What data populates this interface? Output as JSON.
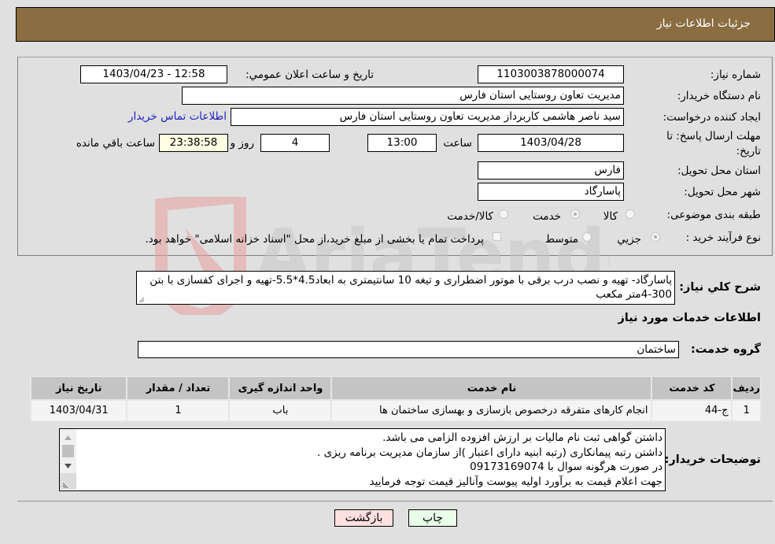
{
  "header": {
    "title": "جزئيات اطلاعات نياز"
  },
  "fields": {
    "need_number_label": "شماره نياز:",
    "need_number": "1103003878000074",
    "announce_label": "تاريخ و ساعت اعلان عمومي:",
    "announce_value": "1403/04/23 - 12:58",
    "buyer_org_label": "نام دستگاه خريدار:",
    "buyer_org": "مديريت تعاون روستايی استان فارس",
    "creator_label": "ايجاد کننده درخواست:",
    "creator": "سيد ناصر هاشمی کاربرداز مديريت تعاون روستايی استان فارس",
    "contact_link": "اطلاعات تماس خريدار",
    "deadline_label": "مهلت ارسال پاسخ: تا تاريخ:",
    "deadline_date": "1403/04/28",
    "time_label": "ساعت",
    "deadline_time": "13:00",
    "days_value": "4",
    "days_label": "روز و",
    "remaining_time": "23:38:58",
    "remaining_label": "ساعت باقي مانده",
    "province_label": "استان محل تحويل:",
    "province": "فارس",
    "city_label": "شهر محل تحويل:",
    "city": "پاسارگاد",
    "category_label": "طبقه بندی موضوعی:",
    "category_options": [
      "کالا",
      "خدمت",
      "کالا/خدمت"
    ],
    "category_selected": "خدمت",
    "process_label": "نوع فرآيند خريد :",
    "process_options": [
      "جزيي",
      "متوسط"
    ],
    "process_selected": "جزيي",
    "treasury_note": "پرداخت تمام يا بخشی از مبلغ خريد،از محل \"اسناد خزانه اسلامی\" خواهد بود."
  },
  "description": {
    "label": "شرح کلي نياز:",
    "text": "پاسارگاد- تهيه و نصب درب برقی با موتور اضطراری و تيغه 10 سانتيمتری به ابعاد4.5*5.5-تهيه و اجرای کفسازی با بتن 300-4متر مکعب"
  },
  "services": {
    "section_title": "اطلاعات خدمات مورد نياز",
    "group_label": "گروه خدمت:",
    "group_value": "ساختمان",
    "columns": [
      "رديف",
      "کد خدمت",
      "نام خدمت",
      "واحد اندازه گيری",
      "تعداد / مقدار",
      "تاريخ نياز"
    ],
    "rows": [
      [
        "1",
        "ج-44",
        "انجام کارهای متفرقه درخصوص بازسازی و بهسازی ساختمان ها",
        "باب",
        "1",
        "1403/04/31"
      ]
    ]
  },
  "buyer_notes": {
    "label": "توضيحات خريدار:",
    "lines": [
      "داشتن گواهی ثبت نام ماليات بر ارزش افزوده الزامی می باشد.",
      "داشتن رتبه پيمانکاری (رتبه ابنيه دارای اعتبار )از سازمان مديريت برنامه ريزی .",
      "در صورت هرگونه سوال با 09173169074",
      "جهت اعلام قيمت به برآورد اوليه پيوست وآناليز قيمت توجه فرماييد"
    ]
  },
  "buttons": {
    "print": "چاپ",
    "back": "بازگشت"
  },
  "colors": {
    "header_bg": "#8b6d42",
    "print_bg": "#eaffea",
    "back_bg": "#ffe0e0",
    "remaining_bg": "#ffffe4",
    "link": "#2020c0"
  },
  "watermark": {
    "text": "AriaTender.neT"
  }
}
